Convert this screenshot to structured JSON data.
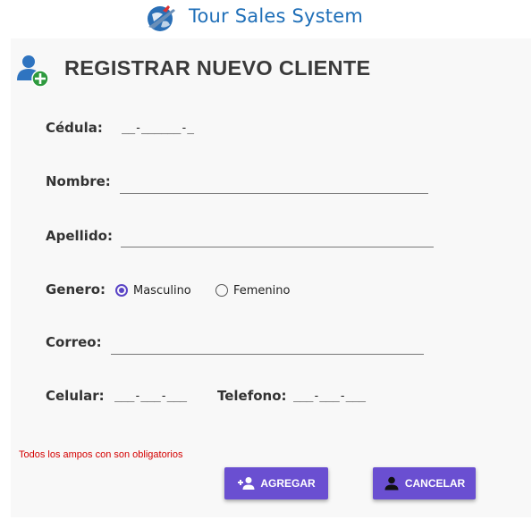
{
  "header": {
    "app_title": "Tour Sales System",
    "logo_icon": "globe-airplane-icon"
  },
  "form": {
    "title": "REGISTRAR NUEVO CLIENTE",
    "title_icon": "add-user-icon",
    "fields": {
      "cedula": {
        "label": "Cédula:",
        "mask": "__-______-_"
      },
      "nombre": {
        "label": "Nombre:",
        "value": ""
      },
      "apellido": {
        "label": "Apellido:",
        "value": ""
      },
      "genero": {
        "label": "Genero:",
        "options": [
          "Masculino",
          "Femenino"
        ],
        "selected": "Masculino"
      },
      "correo": {
        "label": "Correo:",
        "value": ""
      },
      "celular": {
        "label": "Celular:",
        "mask": "___-___-___"
      },
      "telefono": {
        "label": "Telefono:",
        "mask": "___-___-___"
      }
    },
    "warning": "Todos los ampos con son obligatorios",
    "buttons": {
      "agregar": {
        "label": "AGREGAR",
        "icon": "person-add-icon"
      },
      "cancelar": {
        "label": "CANCELAR",
        "icon": "person-icon"
      }
    }
  },
  "colors": {
    "accent": "#6a4fd1",
    "title_blue": "#1f6fb8",
    "warning_red": "#d40000",
    "panel_bg": "#f8f8f8"
  }
}
